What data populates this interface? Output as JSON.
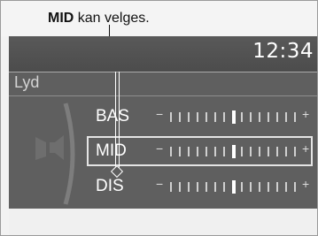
{
  "caption": {
    "bold": "MID",
    "rest": " kan velges."
  },
  "status": {
    "clock": "12:34"
  },
  "section": {
    "title": "Lyd"
  },
  "settings": [
    {
      "label": "BAS",
      "minus": "−",
      "plus": "+",
      "level": 0.5
    },
    {
      "label": "MID",
      "minus": "−",
      "plus": "+",
      "level": 0.5
    },
    {
      "label": "DIS",
      "minus": "−",
      "plus": "+",
      "level": 0.5
    }
  ],
  "selected_index": 1,
  "icons": {
    "speaker": "speaker-icon",
    "arc": "sound-arc-icon"
  }
}
